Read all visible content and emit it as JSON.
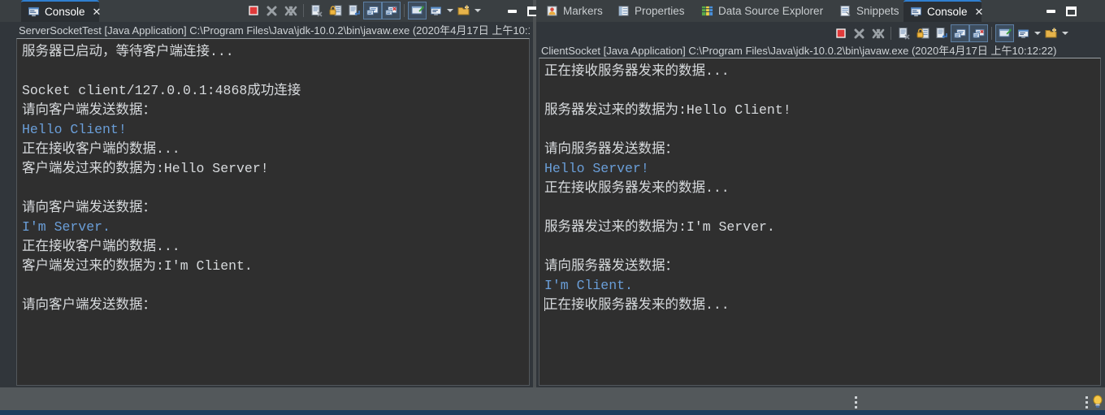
{
  "left_panel": {
    "tab": {
      "label": "Console",
      "close": "✕",
      "icon": "console-icon"
    },
    "launch_label": "ServerSocketTest [Java Application] C:\\Program Files\\Java\\jdk-10.0.2\\bin\\javaw.exe (2020年4月17日 上午10:1",
    "toolbar": [
      {
        "name": "terminate-button",
        "icon": "stop-square-icon"
      },
      {
        "name": "remove-launch-button",
        "icon": "x-icon"
      },
      {
        "name": "remove-all-terminated-button",
        "icon": "double-x-icon"
      },
      {
        "name": "separator",
        "icon": "separator"
      },
      {
        "name": "clear-console-button",
        "icon": "clear-console-icon"
      },
      {
        "name": "scroll-lock-button",
        "icon": "lock-icon"
      },
      {
        "name": "word-wrap-button",
        "icon": "word-wrap-icon"
      },
      {
        "name": "show-console-on-output-button",
        "icon": "console-stdout-icon",
        "framed": true
      },
      {
        "name": "show-console-on-error-button",
        "icon": "console-stderr-icon",
        "framed": true
      },
      {
        "name": "separator2",
        "icon": "separator"
      },
      {
        "name": "pin-console-button",
        "icon": "pin-console-icon",
        "framed": true
      },
      {
        "name": "display-selected-console-button",
        "icon": "display-console-icon"
      },
      {
        "name": "display-selected-console-caret",
        "icon": "chevron-down-icon"
      },
      {
        "name": "open-console-button",
        "icon": "new-console-icon"
      },
      {
        "name": "open-console-caret",
        "icon": "chevron-down-icon"
      }
    ],
    "window_buttons": {
      "minimize": "minimize-icon",
      "maximize": "maximize-icon"
    },
    "console_lines": [
      {
        "text": "服务器已启动，等待客户端连接...",
        "color": "gray"
      },
      {
        "text": "",
        "color": "gray"
      },
      {
        "text": "Socket client/127.0.0.1:4868成功连接",
        "color": "gray"
      },
      {
        "text": "请向客户端发送数据：",
        "color": "gray"
      },
      {
        "text": "Hello Client!",
        "color": "blue"
      },
      {
        "text": "正在接收客户端的数据...",
        "color": "gray"
      },
      {
        "text": "客户端发过来的数据为:Hello Server!",
        "color": "gray"
      },
      {
        "text": "",
        "color": "gray"
      },
      {
        "text": "请向客户端发送数据：",
        "color": "gray"
      },
      {
        "text": "I'm Server.",
        "color": "blue"
      },
      {
        "text": "正在接收客户端的数据...",
        "color": "gray"
      },
      {
        "text": "客户端发过来的数据为:I'm Client.",
        "color": "gray"
      },
      {
        "text": "",
        "color": "gray"
      },
      {
        "text": "请向客户端发送数据：",
        "color": "gray"
      }
    ]
  },
  "right_panel": {
    "tabs": [
      {
        "label": "Markers",
        "icon": "markers-icon",
        "active": false
      },
      {
        "label": "Properties",
        "icon": "properties-icon",
        "active": false
      },
      {
        "label": "Data Source Explorer",
        "icon": "data-source-explorer-icon",
        "active": false
      },
      {
        "label": "Snippets",
        "icon": "snippets-icon",
        "active": false
      },
      {
        "label": "Console",
        "icon": "console-icon",
        "active": true,
        "close": "✕"
      }
    ],
    "launch_label": "ClientSocket [Java Application] C:\\Program Files\\Java\\jdk-10.0.2\\bin\\javaw.exe (2020年4月17日 上午10:12:22)",
    "toolbar": [
      {
        "name": "terminate-button",
        "icon": "stop-square-icon"
      },
      {
        "name": "remove-launch-button",
        "icon": "x-icon"
      },
      {
        "name": "remove-all-terminated-button",
        "icon": "double-x-icon"
      },
      {
        "name": "separator",
        "icon": "separator"
      },
      {
        "name": "clear-console-button",
        "icon": "clear-console-icon"
      },
      {
        "name": "scroll-lock-button",
        "icon": "lock-icon"
      },
      {
        "name": "word-wrap-button",
        "icon": "word-wrap-icon"
      },
      {
        "name": "show-console-on-output-button",
        "icon": "console-stdout-icon",
        "framed": true
      },
      {
        "name": "show-console-on-error-button",
        "icon": "console-stderr-icon",
        "framed": true
      },
      {
        "name": "separator2",
        "icon": "separator"
      },
      {
        "name": "pin-console-button",
        "icon": "pin-console-icon",
        "framed": true
      },
      {
        "name": "display-selected-console-button",
        "icon": "display-console-icon"
      },
      {
        "name": "display-selected-console-caret",
        "icon": "chevron-down-icon"
      },
      {
        "name": "open-console-button",
        "icon": "new-console-icon"
      },
      {
        "name": "open-console-caret",
        "icon": "chevron-down-icon"
      }
    ],
    "window_buttons": {
      "minimize": "minimize-icon",
      "maximize": "maximize-icon"
    },
    "console_lines": [
      {
        "text": "正在接收服务器发来的数据...",
        "color": "gray"
      },
      {
        "text": "",
        "color": "gray"
      },
      {
        "text": "服务器发过来的数据为:Hello Client!",
        "color": "gray"
      },
      {
        "text": "",
        "color": "gray"
      },
      {
        "text": "请向服务器发送数据：",
        "color": "gray"
      },
      {
        "text": "Hello Server!",
        "color": "blue"
      },
      {
        "text": "正在接收服务器发来的数据...",
        "color": "gray"
      },
      {
        "text": "",
        "color": "gray"
      },
      {
        "text": "服务器发过来的数据为:I'm Server.",
        "color": "gray"
      },
      {
        "text": "",
        "color": "gray"
      },
      {
        "text": "请向服务器发送数据：",
        "color": "gray"
      },
      {
        "text": "I'm Client.",
        "color": "blue"
      },
      {
        "text": "正在接收服务器发来的数据...",
        "color": "gray",
        "caret": true
      }
    ]
  },
  "status_bar": {
    "left_grip": "resize-grip",
    "right_grip": "resize-grip",
    "bulb": "tip-bulb-icon"
  },
  "colors": {
    "window_bg": "#4e5254",
    "panel_bg": "#31363b",
    "tabbar_bg": "#3a3f42",
    "active_tab_bg": "#2b2f33",
    "active_tab_accent": "#2f7fd0",
    "console_bg": "#2f2f2f",
    "console_text": "#d7dadd",
    "console_input_blue": "#6a9ed8",
    "status_bg": "#53585b",
    "status_accent": "#1d3b5c",
    "toolbar_frame": "#5d7fa3"
  }
}
